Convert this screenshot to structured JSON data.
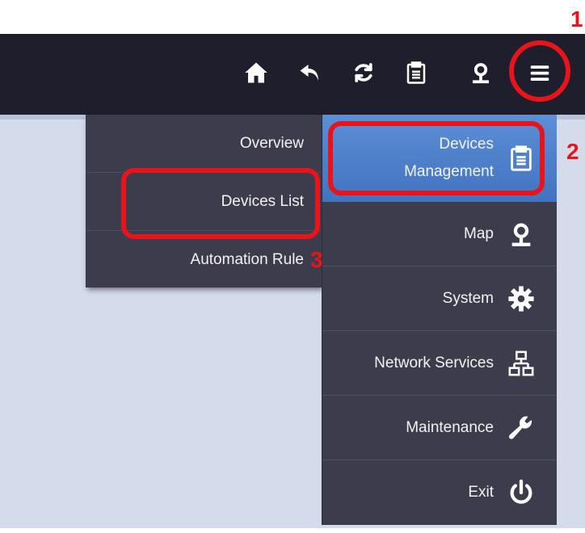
{
  "toolbar": {
    "icons": [
      "home-icon",
      "undo-icon",
      "refresh-icon",
      "clipboard-icon",
      "location-pin-icon",
      "hamburger-menu-icon"
    ]
  },
  "menu": {
    "items": [
      {
        "label_line1": "Devices",
        "label_line2": "Management",
        "icon": "clipboard-icon",
        "active": true
      },
      {
        "label": "Map",
        "icon": "location-pin-icon"
      },
      {
        "label": "System",
        "icon": "gear-icon"
      },
      {
        "label": "Network Services",
        "icon": "network-icon"
      },
      {
        "label": "Maintenance",
        "icon": "wrench-icon"
      },
      {
        "label": "Exit",
        "icon": "power-icon"
      }
    ]
  },
  "submenu": {
    "items": [
      {
        "label": "Overview"
      },
      {
        "label": "Devices List"
      },
      {
        "label": "Automation Rule"
      }
    ]
  },
  "annotations": {
    "step1": "1",
    "step2": "2",
    "step3": "3",
    "color": "#e8141c"
  },
  "colors": {
    "topbar": "#1e1e2c",
    "menu_bg": "#3c3c4c",
    "active_item": "#4f82cb",
    "content_bg": "#d4dcec"
  }
}
